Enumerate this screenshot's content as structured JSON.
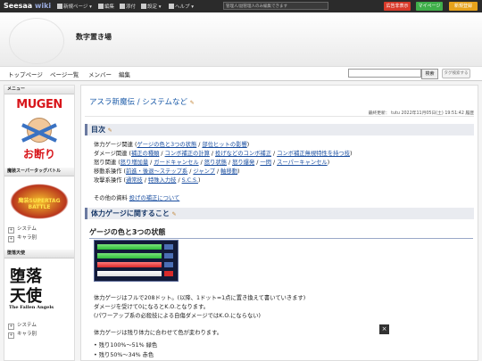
{
  "topbar": {
    "logo_main": "Seesaa",
    "logo_wiki": "wiki",
    "menu": [
      "新規ページ ▾",
      "編集",
      "添付",
      "設定 ▾",
      "ヘルプ ▾"
    ],
    "notice": "管理人/副管理人のみ編集できます",
    "buttons": [
      {
        "label": "広告非表示",
        "color": "#d83a2a"
      },
      {
        "label": "マイページ",
        "color": "#3fae4a"
      },
      {
        "label": "新規登録",
        "color": "#e7a21b"
      }
    ]
  },
  "site": {
    "title": "数字置き場"
  },
  "nav": {
    "items": [
      "トップページ",
      "ページ一覧",
      "メンバー",
      "編集"
    ],
    "search_button": "検索",
    "tag_button": "タグ検索する"
  },
  "sidebar": {
    "menu_title": "メニュー",
    "mugen_line1": "MUGEN",
    "mugen_line2": "お断り",
    "section1_title": "魔装スーパータッグバトル",
    "section1_logo": "魔装SUPERTAG BATTLE",
    "section1_items": [
      "システム",
      "キャラ別"
    ],
    "section2_title": "堕落天使",
    "section2_logo_jp1": "堕落",
    "section2_logo_jp2": "天使",
    "section2_logo_en": "The Fallen Angels",
    "section2_items": [
      "システム",
      "キャラ別"
    ]
  },
  "main": {
    "title": "アスラ新魔伝 / システムなど",
    "meta": "最終更新：  tutu 2022年11月05日(土) 19:51:42 履歴",
    "toc_heading": "目次",
    "toc": [
      {
        "label": "体力ゲージ関連 (",
        "links": [
          "ゲージの色と3つの状態",
          "部位ヒットの影響"
        ]
      },
      {
        "label": "ダメージ関連 (",
        "links": [
          "補正の種類",
          "コンボ補正の計算",
          "投げなどのコンボ補正",
          "コンボ補正無視特性を持つ技"
        ]
      },
      {
        "label": "怒り関連 (",
        "links": [
          "怒り増加量",
          "ガードキャンセル",
          "怒り状態",
          "怒り爆発",
          "一閃",
          "スーパーキャンセル"
        ]
      },
      {
        "label": "移動系操作 (",
        "links": [
          "前進・後退〜ステップ系",
          "ジャンプ",
          "軸移動"
        ]
      },
      {
        "label": "攻撃系操作 (",
        "links": [
          "通常技",
          "特殊入力技",
          "S.C.S."
        ]
      }
    ],
    "other_label": "その他の資料",
    "other_link": "投げの補正について",
    "section_heading": "体力ゲージに関すること",
    "sub_heading": "ゲージの色と3つの状態",
    "gauge_bars": [
      {
        "color": "#2fbf3a"
      },
      {
        "color": "#d92a2a"
      },
      {
        "color": "#e8d43a"
      },
      {
        "color": "#ffffff"
      }
    ],
    "para1": "体力ゲージはフルで208ドット。(以降、1ドット=1点に置き換えて書いていきます)",
    "para2": "ダメージを受けて0になるとK.O.となります。",
    "para3": "(パワーアップ系の必殺技による自傷ダメージではK.O.にならない)",
    "para4": "体力ゲージは残り体力に合わせて色が変わります。",
    "bullets": [
      "残り100%〜51% 緑色",
      "残り50%〜34% 赤色"
    ]
  }
}
